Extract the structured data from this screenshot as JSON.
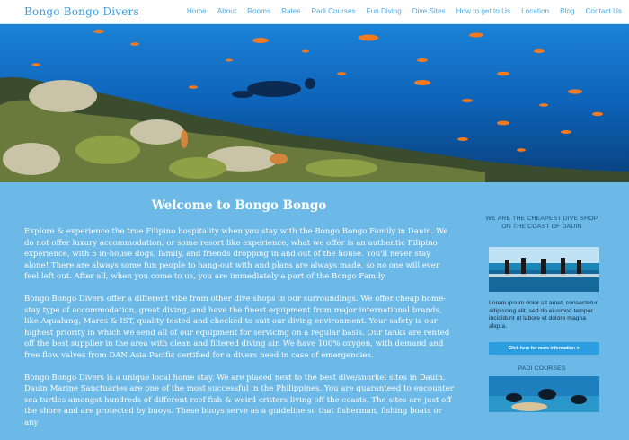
{
  "header": {
    "brand": "Bongo Bongo Divers",
    "nav": [
      "Home",
      "About",
      "Rooms",
      "Rates",
      "Padi Courses",
      "Fun Diving",
      "Dive Sites",
      "How to get to Us",
      "Location",
      "Blog",
      "Contact Us"
    ]
  },
  "hero": {
    "slides": 3,
    "active_slide": 2
  },
  "main": {
    "title": "Welcome to Bongo Bongo",
    "paragraphs": [
      "Explore & experience the true Filipino hospitality when you stay with the Bongo Bongo Family in Dauin. We do not offer luxury accommodation, or some resort like experience, what we offer is an authentic Filipino experience, with 5 in-house dogs, family, and friends dropping in and out of the house. You'll never stay alone! There are always some fun people to hang-out with and plans are always made, so no one will ever feel left out. After all, when you come to us, you are immediately a part of the Bongo Family.",
      "Bongo Bongo Divers offer a different vibe from other dive shops in our surroundings. We offer cheap home-stay type of accommodation, great diving, and have the finest equipment from major international brands, like Aqualung, Mares & IST, quality tested and checked to suit our diving environment. Your safety is our highest priority in which we send all of our equipment for servicing on a regular basis. Our tanks are rented off the best supplier in the area with clean and filtered diving air. We have 100% oxygen, with demand and free flow valves from DAN Asia Pacific certified for a divers need in case of emergencies.",
      "Bongo Bongo Divers is a unique local home stay. We are placed next to the best dive/snorkel sites in Dauin. Dauin Marine Sanctuaries are one of the most successful in the Philippines. You are guaranteed to encounter sea turtles amongst hundreds of different reef fish & weird critters living off the coasts. The sites are just off the shore and are protected by buoys. These buoys serve as a guideline so that fisherman, fishing boats or any"
    ]
  },
  "sidebar": {
    "title": "WE ARE THE CHEAPEST DIVE SHOP ON THE COAST OF DAUIN",
    "text": "Lorem ipsum dolor sit amet, consectetur adipiscing elit, sed do eiusmod tempor incididunt ut labore et dolore magna aliqua.",
    "button": "Click here for more information  ➤",
    "padi_title": "PADI COURSES"
  },
  "colors": {
    "page_bg": "#6cb8e6",
    "brand": "#3d9fdc",
    "nav": "#51a9e0",
    "button": "#2c9ee0"
  }
}
